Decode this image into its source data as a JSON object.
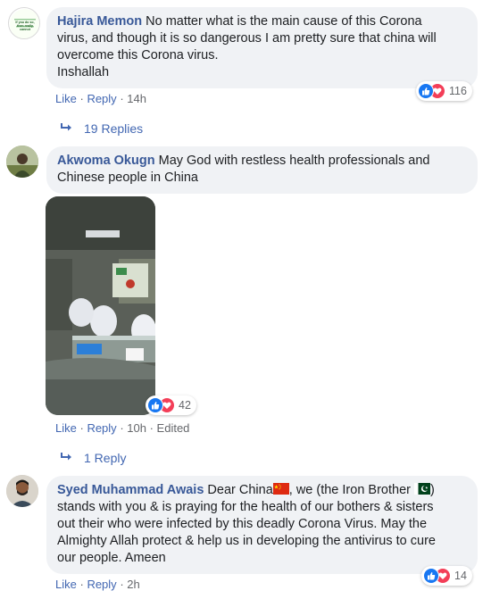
{
  "comments": [
    {
      "author": "Hajira Memon",
      "text_lines": [
        "No matter what is the main cause of this Corona",
        "virus, and though it is so dangerous I am pretty sure that china will",
        "overcome this Corona virus.",
        "Inshallah"
      ],
      "like_label": "Like",
      "reply_label": "Reply",
      "time": "14h",
      "reaction_count": "116",
      "replies_label": "19 Replies",
      "avatar_text": [
        "If you do so,",
        "then really cannot"
      ]
    },
    {
      "author": "Akwoma Okugn",
      "text_lines": [
        "May God with restless health professionals and",
        "Chinese people in China"
      ],
      "like_label": "Like",
      "reply_label": "Reply",
      "time": "10h",
      "edited": "Edited",
      "reaction_count": "42",
      "replies_label": "1 Reply"
    },
    {
      "author": "Syed Muhammad Awais",
      "text_lines": [
        "Dear China",
        ", we (the Iron Brother ",
        ")",
        "stands with you & is praying for the health of our bothers & sisters",
        "out their who were infected by this deadly Corona Virus. May the",
        "Almighty Allah protect & help us in developing the antivirus to cure",
        "our people. Ameen"
      ],
      "like_label": "Like",
      "reply_label": "Reply",
      "time": "2h",
      "reaction_count": "14"
    }
  ],
  "colors": {
    "author": "#385898",
    "link": "#4267b2",
    "muted": "#65676b",
    "bubble": "#f0f2f5",
    "like": "#1877f2",
    "love": "#f33e58"
  },
  "icons": [
    "reply-arrow-icon",
    "like-reaction-icon",
    "love-reaction-icon",
    "china-flag-icon",
    "pakistan-flag-icon"
  ]
}
